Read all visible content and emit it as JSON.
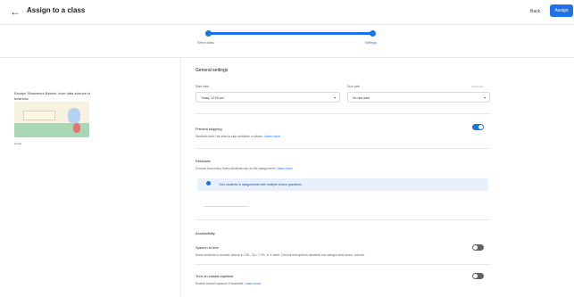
{
  "header": {
    "title": "Assign to a class",
    "back_icon": "arrow-left-icon",
    "back_label": "Back",
    "assign_label": "Assign"
  },
  "stepper": {
    "steps": [
      {
        "label": "Select class",
        "active": false
      },
      {
        "label": "Settings",
        "active": true
      }
    ]
  },
  "lesson": {
    "title": "Escape Shawarma Bakers: from data science to business",
    "meta": "Grade"
  },
  "general": {
    "heading": "General settings",
    "start_date_label": "Start date",
    "start_date_value": "Today, 12:00 am",
    "due_date_label": "Due date",
    "due_date_value": "No due date",
    "due_date_note": "(Optional)"
  },
  "settings": {
    "prevent_skipping": {
      "title": "Prevent skipping",
      "desc": "Students won't be able to skip activities or slides.",
      "link": "Learn more",
      "on": true
    },
    "releases": {
      "title": "Releases",
      "desc": "Choose how many times students can do the assignment.",
      "link": "Learn more"
    },
    "info_note": "Your students in assignments with multiple choice questions",
    "accessibility_heading": "Accessibility",
    "speech_to_text": {
      "title": "Speech to text",
      "desc": "Allow students to answer videos in CSL, SLI, CTS, or 4 other. Get current speech students can always slow down, volume.",
      "on": false
    },
    "closed_captions": {
      "title": "Turn on closed captions",
      "desc": "Enable closed captions if available.",
      "link": "Learn more",
      "on": false
    }
  },
  "colors": {
    "accent": "#1a73e8",
    "info_bg": "#e8f0fe"
  }
}
